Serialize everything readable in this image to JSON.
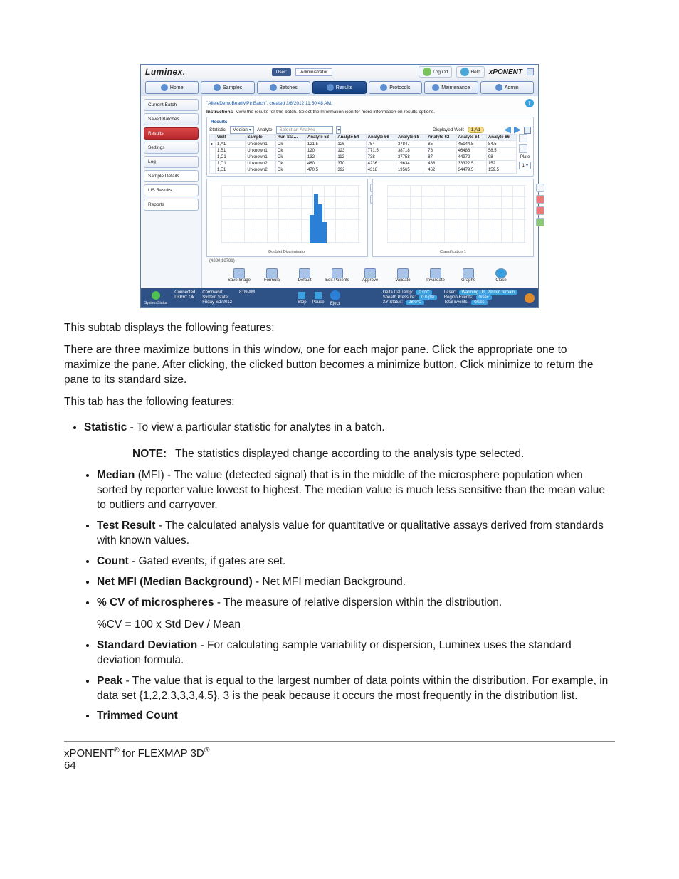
{
  "header": {
    "brand": "Luminex.",
    "user_label": "User:",
    "user_value": "Administrator",
    "logoff": "Log Off",
    "help": "Help",
    "logo2": "xPONENT",
    "tabs": [
      "Home",
      "Samples",
      "Batches",
      "Results",
      "Protocols",
      "Maintenance",
      "Admin"
    ],
    "active_tab": 3
  },
  "sidebar": {
    "items": [
      "Current Batch",
      "Saved Batches",
      "Results",
      "Settings",
      "Log",
      "Sample Details",
      "LIS Results",
      "Reports"
    ],
    "active": 2
  },
  "batch": {
    "title": "\"AlleleDemoBeadMPtriBatch\", created 3/8/2012 11:50:48 AM.",
    "instructions_label": "Instructions",
    "instructions_text": "View the results for this batch. Select the Information icon for more information on results options."
  },
  "results_panel": {
    "heading": "Results",
    "statistic_label": "Statistic:",
    "statistic_value": "Median",
    "analyte_label": "Analyte:",
    "analyte_placeholder": "Select an Analyte",
    "displayed_well_label": "Displayed Well:",
    "displayed_well_value": "1,A1",
    "plate_label": "Plate",
    "plate_value": "1",
    "columns": [
      "Well",
      "Sample",
      "Run Sta…",
      "Analyte 52",
      "Analyte 54",
      "Analyte 56",
      "Analyte 58",
      "Analyte 62",
      "Analyte 64",
      "Analyte 66"
    ],
    "rows": [
      [
        "1,A1",
        "Unknown1",
        "Ok",
        "121.5",
        "126",
        "754",
        "37847",
        "85",
        "45144.5",
        "84.5"
      ],
      [
        "1,B1",
        "Unknown1",
        "Ok",
        "120",
        "123",
        "771.5",
        "38718",
        "78",
        "46488",
        "58.5"
      ],
      [
        "1,C1",
        "Unknown1",
        "Ok",
        "132",
        "112",
        "738",
        "37758",
        "87",
        "44972",
        "98"
      ],
      [
        "1,D1",
        "Unknown2",
        "Ok",
        "460",
        "370",
        "4236",
        "19634",
        "486",
        "33322.5",
        "152"
      ],
      [
        "1,E1",
        "Unknown2",
        "Ok",
        "470.5",
        "392",
        "4318",
        "19565",
        "462",
        "34479.5",
        "159.5"
      ]
    ]
  },
  "charts": {
    "left_xlabel": "Doublet Discriminator",
    "right_xlabel": "Classification 1",
    "coord": "(4330,18781)"
  },
  "buttonbar": [
    "Save Image",
    "Formula",
    "Default",
    "Edit Patients",
    "Approve",
    "Validate",
    "Invalidate",
    "Graphs",
    "Close"
  ],
  "statusbar": {
    "connected": "Connected",
    "dxpro": "DxPro: Ok",
    "sys_status": "System Status",
    "command": "Command:",
    "sys_state": "System State:",
    "date": "Friday 6/1/2012",
    "time": "8:09 AM",
    "stop": "Stop",
    "pause": "Pause",
    "eject": "Eject",
    "dct": "Delta Cal Temp:",
    "dct_v": "0.0°C",
    "sp": "Sheath Pressure:",
    "sp_v": "0.0 psi",
    "xy": "XY Status:",
    "xy_v": "28.0°C",
    "laser": "Laser:",
    "re": "Region Events:",
    "re_v": "0/sec",
    "te": "Total Events:",
    "te_v": "0/sec",
    "warm": "Warming Up, 29 min remain"
  },
  "doc": {
    "p1": "This subtab displays the following features:",
    "p2": "There are three maximize buttons in this window, one for each major pane. Click the appropriate one to maximize the pane. After clicking, the clicked button becomes a minimize button. Click minimize to return the pane to its standard size.",
    "p3": "This tab has the following features:",
    "stat_bold": "Statistic",
    "stat_rest": " - To view a particular statistic for analytes in a batch.",
    "note_label": "NOTE:",
    "note_text": "The statistics displayed change according to the analysis type selected.",
    "median_bold": "Median",
    "median_rest": " (MFI) - The value (detected signal) that is in the middle of the microsphere population when sorted by reporter value lowest to highest. The median value is much less sensitive than the mean value to outliers and carryover.",
    "tr_bold": "Test Result",
    "tr_rest": " - The calculated analysis value for quantitative or qualitative assays derived from standards with known values.",
    "count_bold": "Count",
    "count_rest": " - Gated events, if gates are set.",
    "net_bold": "Net MFI (Median Background)",
    "net_rest": " - Net MFI median Background.",
    "cv_bold": "% CV of microspheres",
    "cv_rest": " - The measure of relative dispersion within the distribution.",
    "cv_formula": "%CV = 100 x Std Dev / Mean",
    "sd_bold": "Standard Deviation",
    "sd_rest": " - For calculating sample variability or dispersion, Luminex uses the standard deviation formula.",
    "peak_bold": "Peak",
    "peak_rest": " - The value that is equal to the largest number of data points within the distribution. For example, in data set {1,2,2,3,3,3,4,5}, 3 is the peak because it occurs the most frequently in the distribution list.",
    "tc_bold": "Trimmed Count"
  },
  "footer": {
    "line1a": "xPONENT",
    "line1b": " for FLEXMAP 3D",
    "pagenum": "64"
  }
}
